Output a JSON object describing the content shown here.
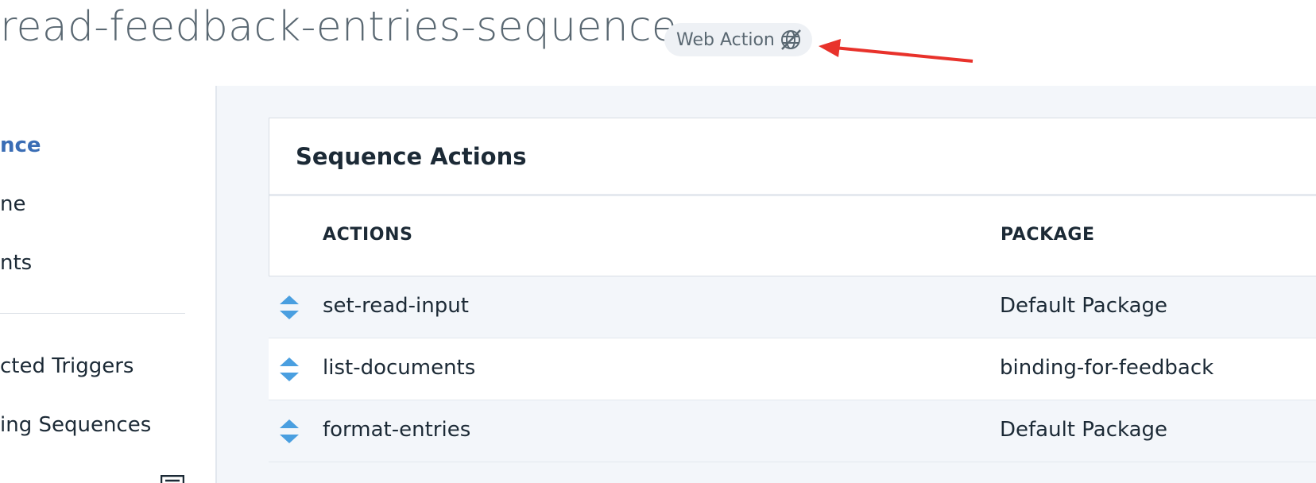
{
  "header": {
    "title": "read-feedback-entries-sequence",
    "badge_label": "Web Action",
    "badge_icon": "web-globe-slash-icon"
  },
  "sidebar": {
    "items": [
      {
        "label": "nce",
        "active": true
      },
      {
        "label": "ne",
        "active": false
      },
      {
        "label": "nts",
        "active": false
      },
      {
        "label": "cted Triggers",
        "active": false
      },
      {
        "label": "ing Sequences",
        "active": false
      }
    ]
  },
  "card": {
    "title": "Sequence Actions",
    "columns": {
      "actions": "ACTIONS",
      "package": "PACKAGE"
    }
  },
  "rows": [
    {
      "action": "set-read-input",
      "package": "Default Package"
    },
    {
      "action": "list-documents",
      "package": "binding-for-feedback"
    },
    {
      "action": "format-entries",
      "package": "Default Package"
    }
  ],
  "colors": {
    "accent": "#3a6db5",
    "arrow": "#e8322b",
    "drag_handle": "#4a9fe0",
    "content_bg": "#f3f6fa"
  }
}
